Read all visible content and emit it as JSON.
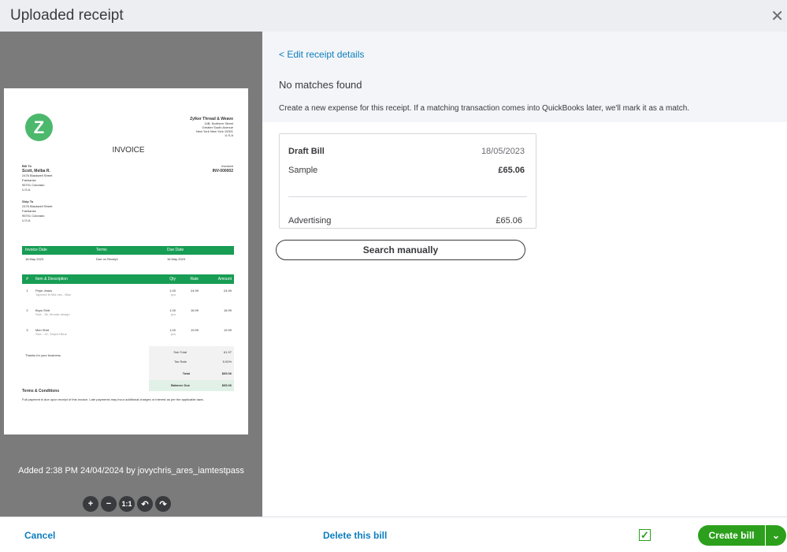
{
  "header": {
    "title": "Uploaded receipt",
    "close_icon": "close-icon"
  },
  "invoice": {
    "logo_letter": "Z",
    "company": "Zylker Thread & Weave",
    "company_addr": [
      "14B, Northern Street",
      "Greater South Avenue",
      "New York New York 10001",
      "U.S.A"
    ],
    "title": "INVOICE",
    "bill_to_label": "Bill To",
    "customer": "Scott, Melba R.",
    "bill_addr": [
      "2476 Blackwell Street",
      "Fairbanks",
      "95701 Colorado",
      "U.S.A"
    ],
    "ship_to_label": "Ship To",
    "ship_addr": [
      "2476 Blackwell Street",
      "Fairbanks",
      "95701 Colorado",
      "U.S.A"
    ],
    "invoice_no_label": "Invoice#",
    "invoice_no": "INV-000002",
    "meta_headers": [
      "Invoice Date",
      "Terms",
      "Due Date"
    ],
    "meta_values": [
      "18 May 2023",
      "Due on Receipt",
      "18 May 2023"
    ],
    "item_headers": [
      "#",
      "Item & Description",
      "Qty",
      "Rate",
      "Amount"
    ],
    "items": [
      {
        "n": "1",
        "name": "Pepe Jeans",
        "desc": "Tapered fit Mid rise - Blue",
        "qty": "1.00",
        "unit": "pcs",
        "rate": "24.99",
        "amount": "24.99"
      },
      {
        "n": "2",
        "name": "Boys Shirt",
        "desc": "Size - 36, Mosaic design",
        "qty": "1.00",
        "unit": "pcs",
        "rate": "16.99",
        "amount": "16.99"
      },
      {
        "n": "3",
        "name": "Men Shirt",
        "desc": "Size - 42, Striped Blue",
        "qty": "1.00",
        "unit": "pcs",
        "rate": "19.99",
        "amount": "19.99"
      }
    ],
    "thanks": "Thanks for your business.",
    "sub_total_label": "Sub Total",
    "sub_total": "61.97",
    "tax_label": "Tax Rate",
    "tax": "5.00%",
    "total_label": "Total",
    "total": "$65.06",
    "balance_label": "Balance Due",
    "balance": "$65.06",
    "terms_label": "Terms & Conditions",
    "terms": "Full payment is due upon receipt of this invoice. Late payments may incur additional charges or interest as per the applicable laws."
  },
  "added_text": "Added 2:38 PM 24/04/2024 by jovychris_ares_iamtestpass",
  "zoom_controls": [
    "+",
    "−",
    "1:1",
    "↶",
    "↷"
  ],
  "right": {
    "edit_link": "< Edit receipt details",
    "heading": "No matches found",
    "description": "Create a new expense for this receipt. If a matching transaction comes into QuickBooks later, we'll mark it as a match.",
    "card": {
      "type": "Draft Bill",
      "date": "18/05/2023",
      "payee": "Sample",
      "amount": "£65.06",
      "category": "Advertising",
      "category_amount": "£65.06"
    },
    "search_button": "Search manually"
  },
  "footer": {
    "cancel": "Cancel",
    "delete": "Delete this bill",
    "checkbox_checked": true,
    "create": "Create bill"
  },
  "colors": {
    "accent": "#2ca01c",
    "link": "#0d7ebf",
    "invoice_green": "#179d54"
  }
}
